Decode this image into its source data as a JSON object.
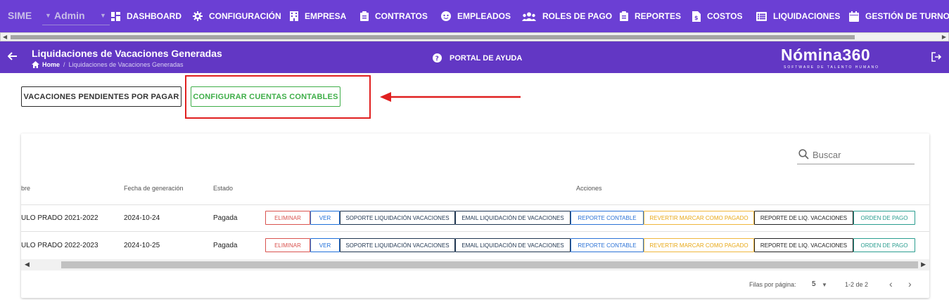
{
  "nav": {
    "brand": "SIME",
    "user": "Admin",
    "items": [
      {
        "label": "DASHBOARD",
        "icon": "dashboard-icon"
      },
      {
        "label": "CONFIGURACIÓN",
        "icon": "gear-icon"
      },
      {
        "label": "EMPRESA",
        "icon": "building-icon"
      },
      {
        "label": "CONTRATOS",
        "icon": "clipboard-icon"
      },
      {
        "label": "EMPLEADOS",
        "icon": "face-icon"
      },
      {
        "label": "ROLES DE PAGO",
        "icon": "people-icon"
      },
      {
        "label": "REPORTES",
        "icon": "clipboard-icon"
      },
      {
        "label": "COSTOS",
        "icon": "dollar-file-icon"
      },
      {
        "label": "LIQUIDACIONES",
        "icon": "list-icon"
      },
      {
        "label": "GESTIÓN DE TURNOS",
        "icon": "calendar-icon"
      }
    ]
  },
  "header": {
    "title": "Liquidaciones de Vacaciones Generadas",
    "breadcrumb_home": "Home",
    "breadcrumb_sep": "/",
    "breadcrumb_current": "Liquidaciones de Vacaciones Generadas",
    "help": "PORTAL DE AYUDA",
    "logo": "Nómina360",
    "logo_tagline": "SOFTWARE DE TALENTO HUMANO"
  },
  "actions": {
    "pending": "VACACIONES PENDIENTES POR PAGAR",
    "configure": "CONFIGURAR CUENTAS CONTABLES"
  },
  "table": {
    "search_placeholder": "Buscar",
    "columns": [
      "bre",
      "Fecha de generación",
      "Estado",
      "Acciones"
    ],
    "rows": [
      {
        "name": "ULO PRADO 2021-2022",
        "date": "2024-10-24",
        "status": "Pagada"
      },
      {
        "name": "ULO PRADO 2022-2023",
        "date": "2024-10-25",
        "status": "Pagada"
      }
    ],
    "row_actions": [
      "ELIMINAR",
      "VER",
      "SOPORTE LIQUIDACIÓN VACACIONES",
      "EMAIL LIQUIDACIÓN DE VACACIONES",
      "REPORTE CONTABLE",
      "REVERTIR MARCAR COMO PAGADO",
      "REPORTE DE LIQ. VACACIONES",
      "ORDEN DE PAGO"
    ],
    "rows_per_page_label": "Filas por página:",
    "rows_per_page": "5",
    "range": "1-2 de 2"
  },
  "colors": {
    "nav_bg": "#6b3fd4",
    "header_bg": "#6237c4",
    "configure_green": "#3fae49",
    "highlight_red": "#e02020"
  }
}
